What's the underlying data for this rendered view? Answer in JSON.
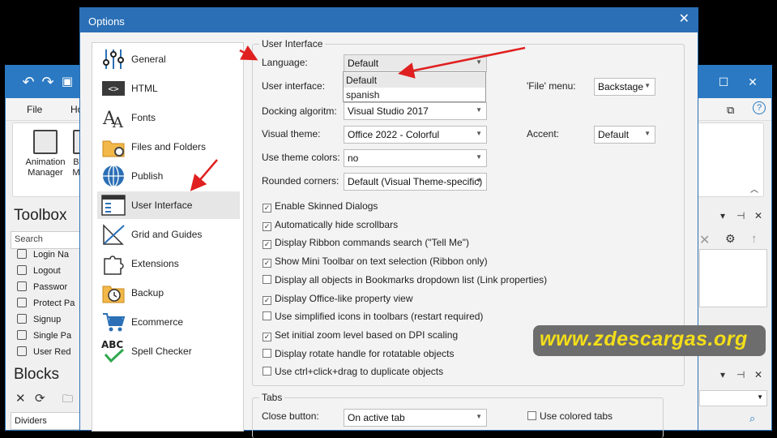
{
  "dialog": {
    "title": "Options",
    "close_icon": "✕"
  },
  "nav": [
    {
      "label": "General",
      "icon": "sliders-icon"
    },
    {
      "label": "HTML",
      "icon": "code-icon"
    },
    {
      "label": "Fonts",
      "icon": "fonts-icon"
    },
    {
      "label": "Files and Folders",
      "icon": "folder-gear-icon"
    },
    {
      "label": "Publish",
      "icon": "globe-icon"
    },
    {
      "label": "User Interface",
      "icon": "window-icon",
      "selected": true
    },
    {
      "label": "Grid and Guides",
      "icon": "ruler-icon"
    },
    {
      "label": "Extensions",
      "icon": "puzzle-icon"
    },
    {
      "label": "Backup",
      "icon": "clock-icon"
    },
    {
      "label": "Ecommerce",
      "icon": "cart-icon"
    },
    {
      "label": "Spell Checker",
      "icon": "abc-check-icon"
    }
  ],
  "ui_group": {
    "title": "User Interface",
    "language_label": "Language:",
    "language_value": "Default",
    "dropdown_options": [
      "Default",
      "spanish"
    ],
    "user_interface_label": "User interface:",
    "file_menu_label": "'File' menu:",
    "file_menu_value": "Backstage",
    "docking_label": "Docking algoritm:",
    "docking_value": "Visual Studio 2017",
    "theme_label": "Visual theme:",
    "theme_value": "Office 2022 - Colorful",
    "accent_label": "Accent:",
    "accent_value": "Default",
    "theme_colors_label": "Use theme colors:",
    "theme_colors_value": "no",
    "rounded_label": "Rounded corners:",
    "rounded_value": "Default (Visual Theme-specific)",
    "checkboxes": [
      {
        "label": "Enable Skinned Dialogs",
        "checked": true
      },
      {
        "label": "Automatically hide scrollbars",
        "checked": true
      },
      {
        "label": "Display Ribbon commands search (\"Tell Me\")",
        "checked": true
      },
      {
        "label": "Show Mini Toolbar on text selection (Ribbon only)",
        "checked": true
      },
      {
        "label": "Display all objects in Bookmarks dropdown list (Link properties)",
        "checked": false
      },
      {
        "label": "Display Office-like property view",
        "checked": true
      },
      {
        "label": "Use simplified icons in toolbars (restart required)",
        "checked": false
      },
      {
        "label": "Set initial zoom level based on DPI scaling",
        "checked": true
      },
      {
        "label": "Display rotate handle for rotatable objects",
        "checked": false
      },
      {
        "label": "Use ctrl+click+drag to duplicate objects",
        "checked": false
      }
    ]
  },
  "tabs_group": {
    "title": "Tabs",
    "close_button_label": "Close button:",
    "close_button_value": "On active tab",
    "colored_tabs_label": "Use colored tabs",
    "colored_tabs_checked": false
  },
  "bgapp": {
    "menu_file": "File",
    "menu_home": "Ho",
    "ribbon_animation": "Animation Manager",
    "ribbon_b": "Ba Ma",
    "toolbox_title": "Toolbox",
    "search_placeholder": "Search",
    "toolbox_items": [
      "Login Na",
      "Logout",
      "Passwor",
      "Protect Pa",
      "Signup",
      "Single Pa",
      "User Red"
    ],
    "blocks_title": "Blocks",
    "dividers_label": "Dividers"
  },
  "watermark": "www.zdescargas.org",
  "colors": {
    "accent": "#2b6fb6",
    "arrow": "#e02020",
    "watermark_text": "#f3de19"
  }
}
